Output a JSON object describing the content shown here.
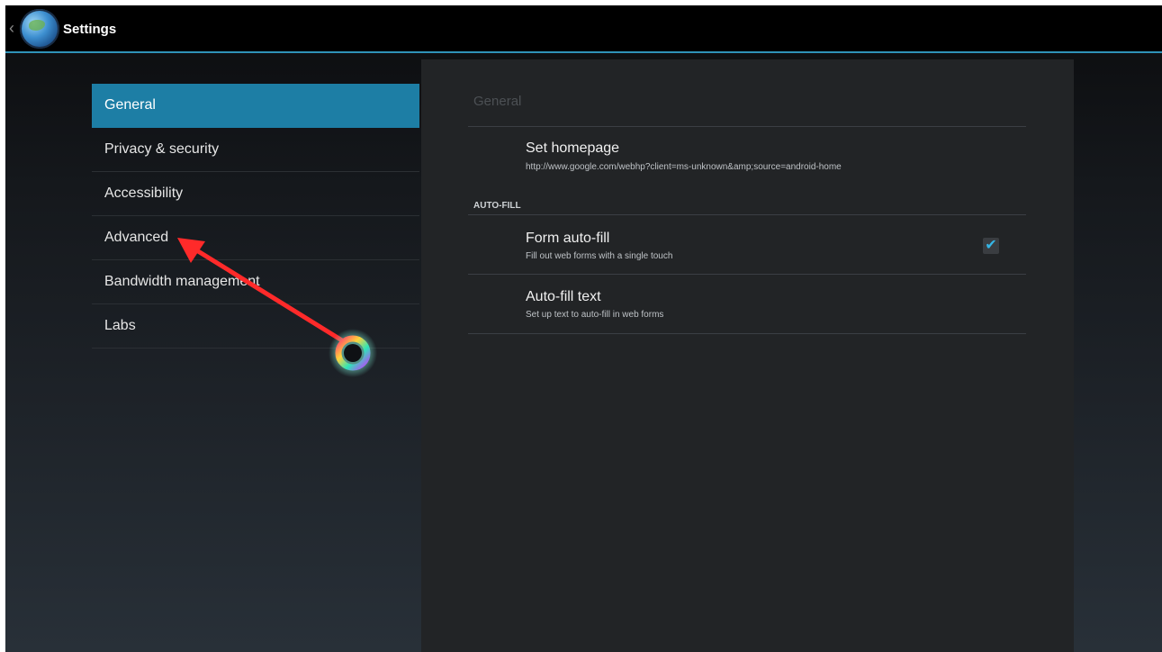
{
  "actionbar": {
    "title": "Settings",
    "back_icon": "chevron-left-icon",
    "app_icon": "browser-globe-icon"
  },
  "sidebar": {
    "items": [
      {
        "label": "General",
        "selected": true
      },
      {
        "label": "Privacy & security",
        "selected": false
      },
      {
        "label": "Accessibility",
        "selected": false
      },
      {
        "label": "Advanced",
        "selected": false
      },
      {
        "label": "Bandwidth management",
        "selected": false
      },
      {
        "label": "Labs",
        "selected": false
      }
    ]
  },
  "main": {
    "title": "General",
    "homepage": {
      "title": "Set homepage",
      "summary": "http://www.google.com/webhp?client=ms-unknown&amp;source=android-home"
    },
    "autofill_header": "AUTO-FILL",
    "form_autofill": {
      "title": "Form auto-fill",
      "summary": "Fill out web forms with a single touch",
      "checked": true
    },
    "autofill_text": {
      "title": "Auto-fill text",
      "summary": "Set up text to auto-fill in web forms"
    }
  },
  "annotation": {
    "arrow_color": "#ff2a2a",
    "cursor_icon": "touch-cursor-ring-icon"
  },
  "colors": {
    "accent": "#1d7ea5",
    "actionbar_line": "#2f93b8",
    "checkmark": "#35b6e6"
  }
}
